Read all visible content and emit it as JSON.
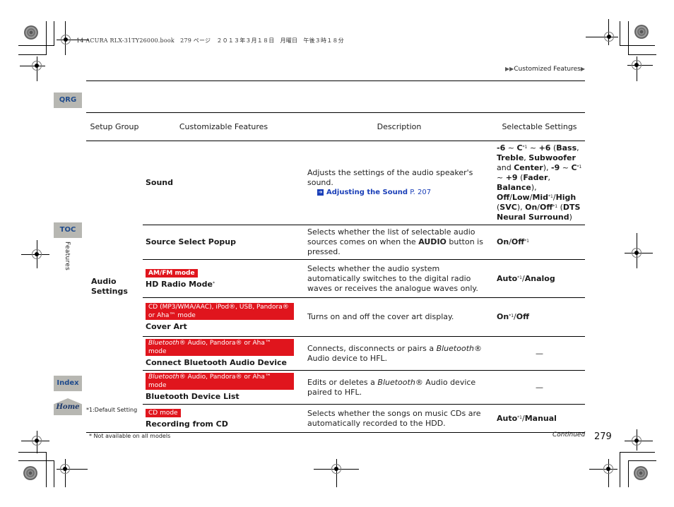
{
  "book_header": "14 ACURA RLX-31TY26000.book　279 ページ　２０１３年３月１８日　月曜日　午後３時１８分",
  "breadcrumb": {
    "prefix_icon": "double-right-triangle",
    "label": "Customized Features",
    "suffix_icon": "right-triangle"
  },
  "side_nav": {
    "qrg": "QRG",
    "toc": "TOC",
    "section": "Features",
    "index": "Index",
    "home": "Home"
  },
  "table": {
    "headers": [
      "Setup Group",
      "Customizable Features",
      "Description",
      "Selectable Settings"
    ],
    "group": "Audio Settings",
    "rows": [
      {
        "mode_tag": "",
        "feature": "Sound",
        "description": "Adjusts the settings of the audio speaker's sound.",
        "link_label": "Adjusting the Sound",
        "link_page": "P. 207",
        "settings": "-6 ~ C*1 ~ +6 (Bass, Treble, Subwoofer and Center), -9 ~ C*1 ~ +9 (Fader, Balance), Off/Low/Mid*1/High (SVC), On/Off*1 (DTS Neural Surround)"
      },
      {
        "mode_tag": "",
        "feature": "Source Select Popup",
        "description": "Selects whether the list of selectable audio sources comes on when the AUDIO button is pressed.",
        "settings": "On/Off*1"
      },
      {
        "mode_tag": "AM/FM mode",
        "feature": "HD Radio Mode*",
        "description": "Selects whether the audio system automatically switches to the digital radio waves or receives the analogue waves only.",
        "settings": "Auto*1/Analog"
      },
      {
        "mode_tag": "CD (MP3/WMA/AAC), iPod®, USB, Pandora® or Aha™ mode",
        "feature": "Cover Art",
        "description": "Turns on and off the cover art display.",
        "settings": "On*1/Off"
      },
      {
        "mode_tag": "Bluetooth® Audio, Pandora® or Aha™ mode",
        "feature": "Connect Bluetooth Audio Device",
        "description": "Connects, disconnects or pairs a Bluetooth® Audio device to HFL.",
        "settings": "—"
      },
      {
        "mode_tag": "Bluetooth® Audio, Pandora® or Aha™ mode",
        "feature": "Bluetooth Device List",
        "description": "Edits or deletes a Bluetooth® Audio device paired to HFL.",
        "settings": "—"
      },
      {
        "mode_tag": "CD mode",
        "feature": "Recording from CD",
        "description": "Selects whether the songs on music CDs are automatically recorded to the HDD.",
        "settings": "Auto*1/Manual"
      }
    ]
  },
  "footnotes": {
    "default_setting": "*1:Default Setting",
    "not_available": "* Not available on all models"
  },
  "continued": "Continued",
  "page_number": "279"
}
